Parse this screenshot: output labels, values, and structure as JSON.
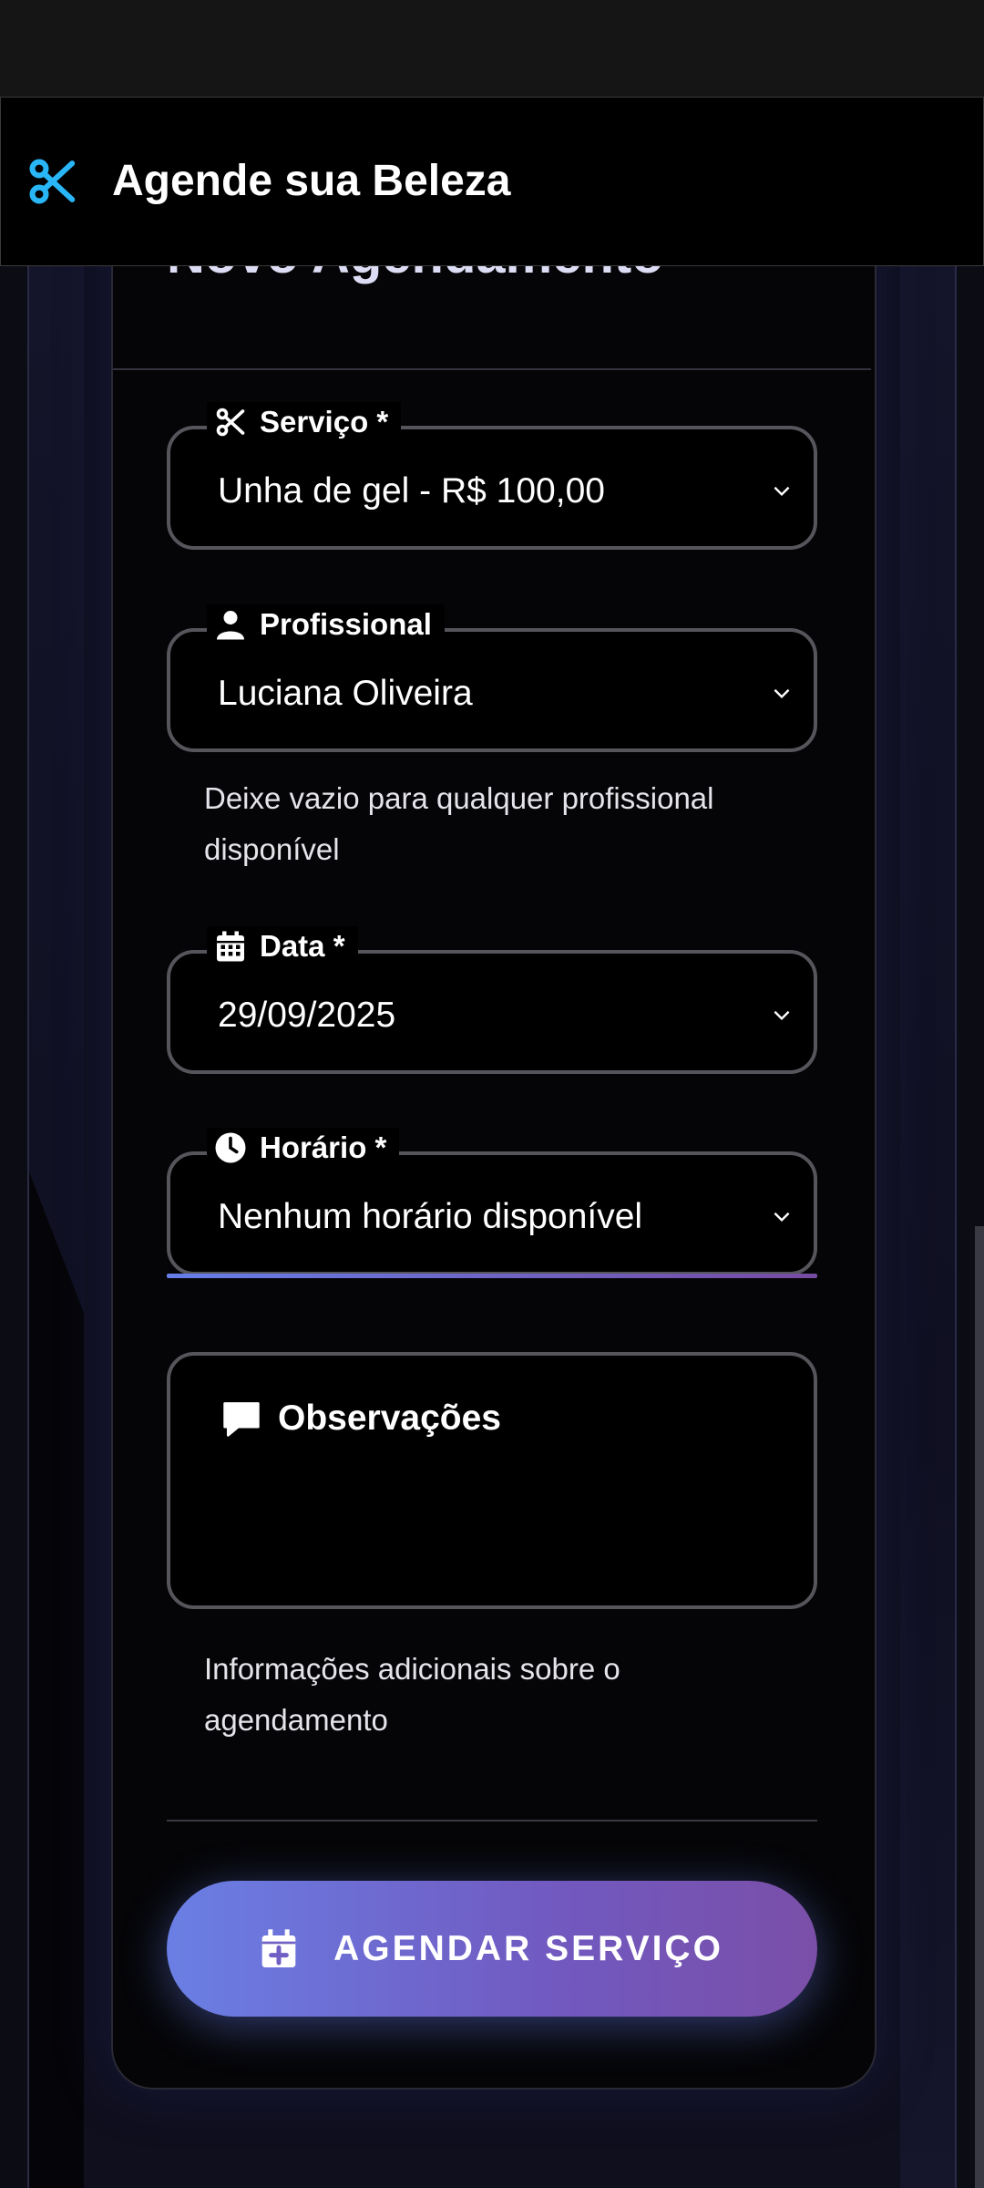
{
  "app": {
    "title": "Agende sua Beleza"
  },
  "form": {
    "title": "Novo Agendamento",
    "service": {
      "label": "Serviço *",
      "value": "Unha de gel - R$ 100,00"
    },
    "professional": {
      "label": "Profissional",
      "value": "Luciana Oliveira",
      "helper": "Deixe vazio para qualquer profissional disponível"
    },
    "date": {
      "label": "Data *",
      "value": "29/09/2025"
    },
    "time": {
      "label": "Horário *",
      "value": "Nenhum horário disponível"
    },
    "notes": {
      "label": "Observações",
      "helper": "Informações adicionais sobre o agendamento"
    },
    "submit_label": "AGENDAR SERVIÇO"
  },
  "icons": {
    "app": "scissors-icon",
    "service": "scissors-icon",
    "professional": "person-icon",
    "date": "calendar-icon",
    "time": "clock-icon",
    "notes": "comment-icon",
    "submit": "calendar-plus-icon"
  },
  "colors": {
    "accent_cyan": "#29b6f6",
    "gradient_start": "#667eea",
    "gradient_end": "#764ba2"
  }
}
